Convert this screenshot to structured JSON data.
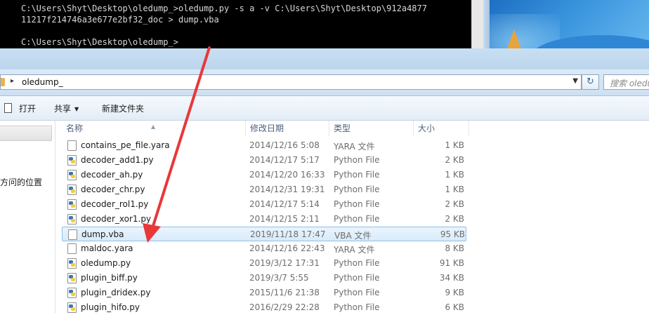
{
  "console": {
    "line1": "C:\\Users\\Shyt\\Desktop\\oledump_>oledump.py -s a -v C:\\Users\\Shyt\\Desktop\\912a4877",
    "line2": "11217f214746a3e677e2bf32_doc > dump.vba",
    "line3": "C:\\Users\\Shyt\\Desktop\\oledump_>"
  },
  "address": {
    "path": "oledump_",
    "separator": "▸",
    "dropdown": "▼"
  },
  "refresh_glyph": "↻",
  "search": {
    "placeholder": "搜索 oledu"
  },
  "toolbar": {
    "open": "打开",
    "share": "共享",
    "new_folder": "新建文件夹",
    "caret": "▼"
  },
  "nav": {
    "recent": "方问的位置"
  },
  "columns": {
    "name": "名称",
    "date": "修改日期",
    "type": "类型",
    "size": "大小",
    "sort_glyph": "▲"
  },
  "files": [
    {
      "name": "contains_pe_file.yara",
      "date": "2014/12/16 5:08",
      "type": "YARA 文件",
      "size": "1 KB",
      "icon": "file-icon"
    },
    {
      "name": "decoder_add1.py",
      "date": "2014/12/17 5:17",
      "type": "Python File",
      "size": "2 KB",
      "icon": "python-file-icon"
    },
    {
      "name": "decoder_ah.py",
      "date": "2014/12/20 16:33",
      "type": "Python File",
      "size": "1 KB",
      "icon": "python-file-icon"
    },
    {
      "name": "decoder_chr.py",
      "date": "2014/12/31 19:31",
      "type": "Python File",
      "size": "1 KB",
      "icon": "python-file-icon"
    },
    {
      "name": "decoder_rol1.py",
      "date": "2014/12/17 5:14",
      "type": "Python File",
      "size": "2 KB",
      "icon": "python-file-icon"
    },
    {
      "name": "decoder_xor1.py",
      "date": "2014/12/15 2:11",
      "type": "Python File",
      "size": "2 KB",
      "icon": "python-file-icon"
    },
    {
      "name": "dump.vba",
      "date": "2019/11/18 17:47",
      "type": "VBA 文件",
      "size": "95 KB",
      "icon": "file-icon",
      "selected": true
    },
    {
      "name": "maldoc.yara",
      "date": "2014/12/16 22:43",
      "type": "YARA 文件",
      "size": "8 KB",
      "icon": "file-icon"
    },
    {
      "name": "oledump.py",
      "date": "2019/3/12 17:31",
      "type": "Python File",
      "size": "91 KB",
      "icon": "python-file-icon"
    },
    {
      "name": "plugin_biff.py",
      "date": "2019/3/7 5:55",
      "type": "Python File",
      "size": "34 KB",
      "icon": "python-file-icon"
    },
    {
      "name": "plugin_dridex.py",
      "date": "2015/11/6 21:38",
      "type": "Python File",
      "size": "9 KB",
      "icon": "python-file-icon"
    },
    {
      "name": "plugin_hifo.py",
      "date": "2016/2/29 22:28",
      "type": "Python File",
      "size": "6 KB",
      "icon": "python-file-icon"
    }
  ],
  "colors": {
    "annotation_arrow": "#e8383a",
    "selection": "#d8ebfb"
  }
}
